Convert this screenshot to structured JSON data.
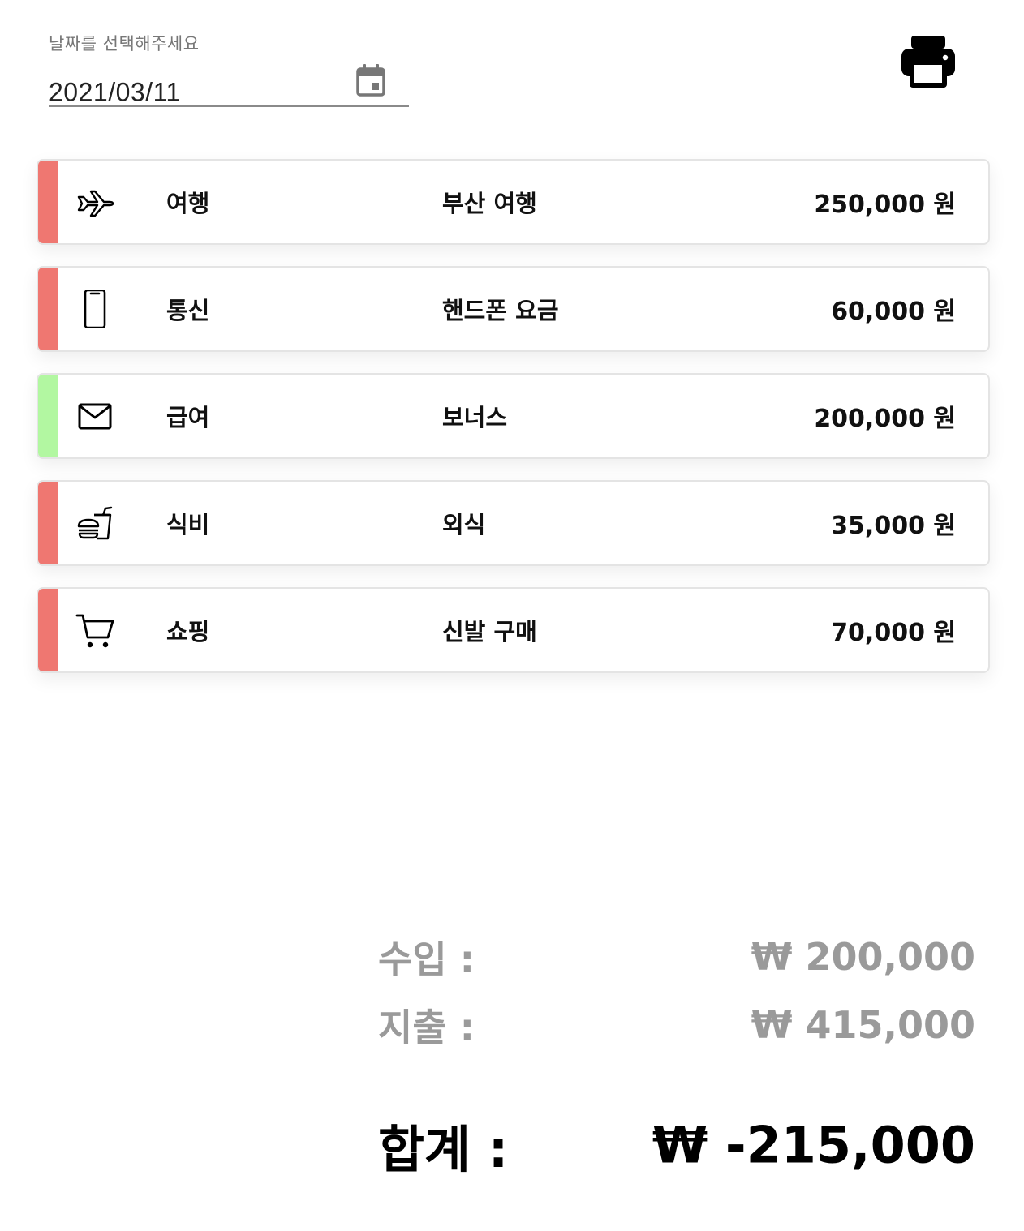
{
  "date_picker": {
    "label": "날짜를 선택해주세요",
    "value": "2021/03/11",
    "icon": "calendar-icon"
  },
  "toolbar": {
    "print_icon": "print-icon"
  },
  "colors": {
    "expense": "#ef7771",
    "income": "#b2f7a1"
  },
  "transactions": [
    {
      "type": "expense",
      "icon": "airplane-icon",
      "category": "여행",
      "memo": "부산 여행",
      "amount": "250,000 원"
    },
    {
      "type": "expense",
      "icon": "smartphone-icon",
      "category": "통신",
      "memo": "핸드폰 요금",
      "amount": "60,000 원"
    },
    {
      "type": "income",
      "icon": "mail-icon",
      "category": "급여",
      "memo": "보너스",
      "amount": "200,000 원"
    },
    {
      "type": "expense",
      "icon": "fastfood-icon",
      "category": "식비",
      "memo": "외식",
      "amount": "35,000 원"
    },
    {
      "type": "expense",
      "icon": "cart-icon",
      "category": "쇼핑",
      "memo": "신발 구매",
      "amount": "70,000 원"
    }
  ],
  "summary": {
    "income_label": "수입 :",
    "income_value": "₩ 200,000",
    "expense_label": "지출 :",
    "expense_value": "₩ 415,000",
    "total_label": "합계 :",
    "total_value": "₩ -215,000"
  }
}
